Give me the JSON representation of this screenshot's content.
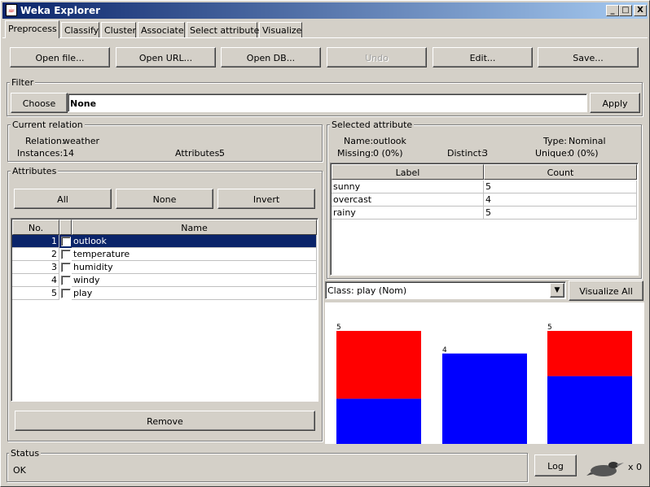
{
  "window": {
    "title": "Weka Explorer",
    "minimize": "_",
    "maximize": "□",
    "close": "X",
    "icon": "java-coffee-icon"
  },
  "tabs": [
    "Preprocess",
    "Classify",
    "Cluster",
    "Associate",
    "Select attributes",
    "Visualize"
  ],
  "toolbar": {
    "open_file": "Open file...",
    "open_url": "Open URL...",
    "open_db": "Open DB...",
    "undo": "Undo",
    "edit": "Edit...",
    "save": "Save..."
  },
  "filter": {
    "title": "Filter",
    "choose": "Choose",
    "value": "None",
    "apply": "Apply"
  },
  "relation": {
    "title": "Current relation",
    "relation_label": "Relation:",
    "relation_value": "weather",
    "instances_label": "Instances:",
    "instances_value": "14",
    "attributes_label": "Attributes:",
    "attributes_value": "5"
  },
  "attributes": {
    "title": "Attributes",
    "all": "All",
    "none": "None",
    "invert": "Invert",
    "col_no": "No.",
    "col_name": "Name",
    "rows": [
      {
        "no": "1",
        "name": "outlook",
        "selected": true
      },
      {
        "no": "2",
        "name": "temperature",
        "selected": false
      },
      {
        "no": "3",
        "name": "humidity",
        "selected": false
      },
      {
        "no": "4",
        "name": "windy",
        "selected": false
      },
      {
        "no": "5",
        "name": "play",
        "selected": false
      }
    ],
    "remove": "Remove"
  },
  "selected": {
    "title": "Selected attribute",
    "name_label": "Name:",
    "name_value": "outlook",
    "type_label": "Type:",
    "type_value": "Nominal",
    "missing_label": "Missing:",
    "missing_value": "0 (0%)",
    "distinct_label": "Distinct:",
    "distinct_value": "3",
    "unique_label": "Unique:",
    "unique_value": "0 (0%)",
    "col_label": "Label",
    "col_count": "Count",
    "rows": [
      {
        "label": "sunny",
        "count": "5"
      },
      {
        "label": "overcast",
        "count": "4"
      },
      {
        "label": "rainy",
        "count": "5"
      }
    ]
  },
  "class_select": {
    "value": "Class: play (Nom)",
    "visualize_all": "Visualize All"
  },
  "chart_data": {
    "type": "bar",
    "categories": [
      "sunny",
      "overcast",
      "rainy"
    ],
    "totals": [
      5,
      4,
      5
    ],
    "series": [
      {
        "values": [
          2,
          4,
          3
        ],
        "color": "#0000ff"
      },
      {
        "values": [
          3,
          0,
          2
        ],
        "color": "#ff0000"
      }
    ],
    "ylim": [
      0,
      5
    ]
  },
  "status": {
    "title": "Status",
    "text": "OK",
    "log": "Log",
    "count": "x 0",
    "icon": "weka-bird-icon"
  }
}
